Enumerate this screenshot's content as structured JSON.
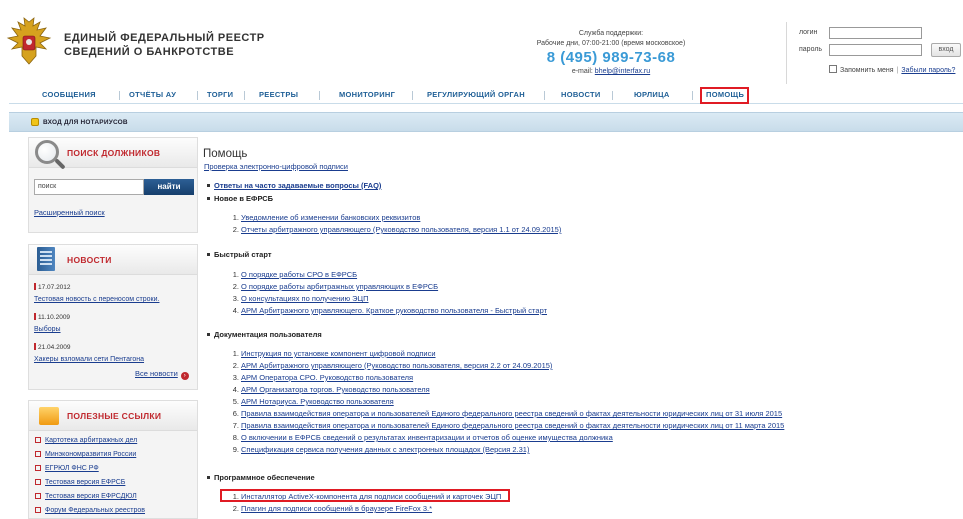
{
  "header": {
    "title_line1": "ЕДИНЫЙ ФЕДЕРАЛЬНЫЙ РЕЕСТР",
    "title_line2": "СВЕДЕНИЙ О БАНКРОТСТВЕ",
    "support_title": "Служба поддержки:",
    "support_hours": "Рабочие дни, 07:00-21:00 (время московское)",
    "support_phone": "8 (495) 989-73-68",
    "support_email_label": "e-mail:",
    "support_email": "bhelp@interfax.ru"
  },
  "login": {
    "login_label": "логин",
    "password_label": "пароль",
    "submit_label": "вход",
    "remember_label": "Запомнить меня",
    "forgot_label": "Забыли пароль?"
  },
  "nav": {
    "items": [
      "СООБЩЕНИЯ",
      "ОТЧЁТЫ АУ",
      "ТОРГИ",
      "РЕЕСТРЫ",
      "МОНИТОРИНГ",
      "РЕГУЛИРУЮЩИЙ ОРГАН",
      "НОВОСТИ",
      "ЮРЛИЦА",
      "ПОМОЩЬ"
    ],
    "notary": "ВХОД ДЛЯ НОТАРИУСОВ"
  },
  "sidebar": {
    "search_title": "ПОИСК ДОЛЖНИКОВ",
    "search_placeholder": "поиск",
    "search_button": "найти",
    "advanced_search": "Расширенный поиск",
    "news_title": "НОВОСТИ",
    "news": [
      {
        "date": "17.07.2012",
        "text": "Тестовая новость с переносом строки."
      },
      {
        "date": "11.10.2009",
        "text": "Выборы"
      },
      {
        "date": "21.04.2009",
        "text": "Хакеры взломали сети Пентагона"
      }
    ],
    "all_news": "Все новости",
    "links_title": "ПОЛЕЗНЫЕ ССЫЛКИ",
    "links": [
      "Картотека арбитражных дел",
      "Минэкономразвития России",
      "ЕГРЮЛ ФНС РФ",
      "Тестовая версия ЕФРСБ",
      "Тестовая версия ЕФРСДЮЛ",
      "Форум Федеральных реестров"
    ]
  },
  "main": {
    "title": "Помощь",
    "sig_check": "Проверка электронно-цифровой подписи",
    "faq": "Ответы на часто задаваемые вопросы (FAQ)",
    "sections": [
      {
        "title": "Новое в ЕФРСБ",
        "items": [
          "Уведомление об изменении банковских реквизитов",
          "Отчеты арбитражного управляющего (Руководство пользователя, версия 1.1 от 24.09.2015)"
        ]
      },
      {
        "title": "Быстрый старт",
        "items": [
          "О порядке работы СРО в ЕФРСБ",
          "О порядке работы арбитражных управляющих в ЕФРСБ",
          "О консультациях по получению ЭЦП",
          "АРМ Арбитражного управляющего. Краткое руководство пользователя - Быстрый старт"
        ]
      },
      {
        "title": "Документация пользователя",
        "items": [
          "Инструкция по установке компонент цифровой подписи",
          "АРМ Арбитражного управляющего (Руководство пользователя, версия 2.2 от 24.09.2015)",
          "АРМ Оператора СРО. Руководство пользователя",
          "АРМ Организатора торгов. Руководство пользователя",
          "АРМ Нотариуса. Руководство пользователя",
          "Правила взаимодействия оператора и пользователей Единого федерального реестра сведений о фактах деятельности юридических лиц от 31 июля 2015",
          "Правила взаимодействия оператора и пользователей Единого федерального реестра сведений о фактах деятельности юридических лиц от 11 марта 2015",
          "О включении в ЕФРСБ сведений о результатах инвентаризации и отчетов об оценке имущества должника",
          "Спецификация сервиса получения данных с электронных площадок (Версия 2.31)"
        ]
      },
      {
        "title": "Программное обеспечение",
        "items": [
          "Инсталлятор ActiveX-компонента для подписи сообщений и карточек ЭЦП",
          "Плагин для подписи сообщений в браузере FireFox 3.*"
        ]
      }
    ]
  },
  "colors": {
    "accent_red": "#e01b24",
    "link": "#1a3d8f",
    "nav": "#1f5f96",
    "phone": "#3a9ad6"
  }
}
